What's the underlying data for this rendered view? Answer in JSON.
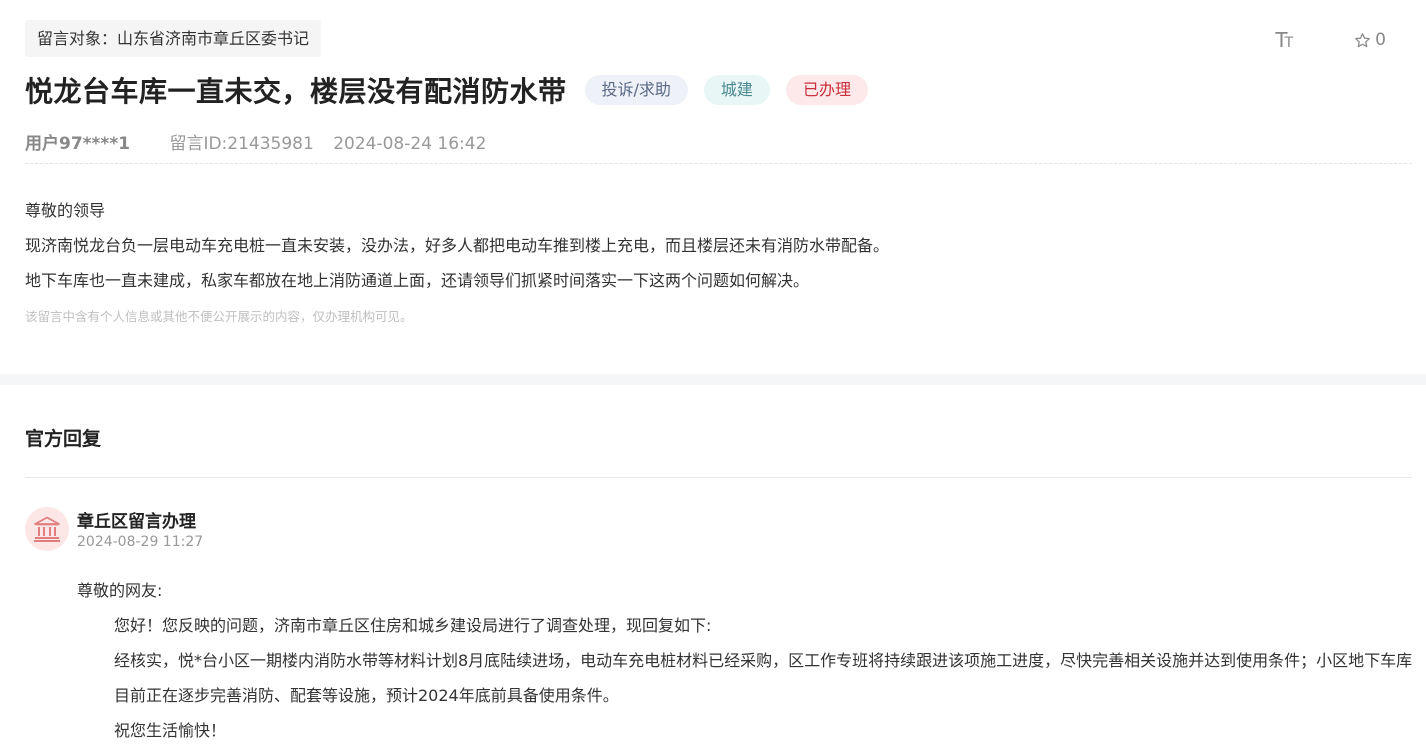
{
  "recipient": "留言对象：山东省济南市章丘区委书记",
  "toolbar": {
    "font_label": "TT",
    "fav_count": "0"
  },
  "title": "悦龙台车库一直未交，楼层没有配消防水带",
  "tags": [
    "投诉/求助",
    "城建",
    "已办理"
  ],
  "meta": {
    "user": "用户97****1",
    "message_id": "留言ID:21435981",
    "datetime": "2024-08-24 16:42"
  },
  "content": [
    "尊敬的领导",
    "现济南悦龙台负一层电动车充电桩一直未安装，没办法，好多人都把电动车推到楼上充电，而且楼层还未有消防水带配备。",
    "地下车库也一直未建成，私家车都放在地上消防通道上面，还请领导们抓紧时间落实一下这两个问题如何解决。"
  ],
  "notice": "该留言中含有个人信息或其他不便公开展示的内容，仅办理机构可见。",
  "reply": {
    "heading": "官方回复",
    "org": "章丘区留言办理",
    "date": "2024-08-29 11:27",
    "greeting": "尊敬的网友:",
    "p1": "您好！您反映的问题，济南市章丘区住房和城乡建设局进行了调查处理，现回复如下:",
    "p2": "经核实，悦*台小区一期楼内消防水带等材料计划8月底陆续进场，电动车充电桩材料已经采购，区工作专班将持续跟进该项施工进度，尽快完善相关设施并达到使用条件；小区地下车库目前正在逐步完善消防、配套等设施，预计2024年底前具备使用条件。",
    "p3": "祝您生活愉快！"
  },
  "colors": {
    "accent_red": "#c9303e",
    "tag_blue": "#5a6a86",
    "tag_teal": "#4a8a92"
  },
  "icons": [
    "font-size-icon",
    "star-icon",
    "government-building-icon"
  ]
}
